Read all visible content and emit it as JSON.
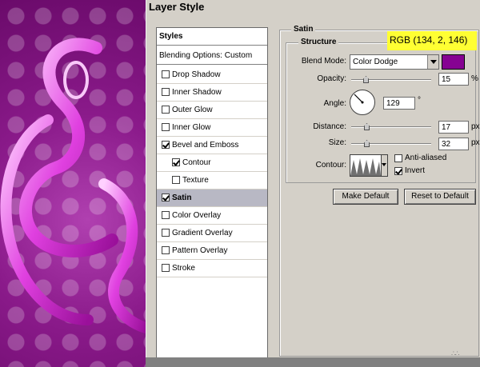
{
  "window": {
    "title": "Layer Style"
  },
  "styles_list": {
    "header": "Styles",
    "blending": "Blending Options: Custom",
    "items": [
      {
        "label": "Drop Shadow",
        "checked": false,
        "selected": false
      },
      {
        "label": "Inner Shadow",
        "checked": false,
        "selected": false
      },
      {
        "label": "Outer Glow",
        "checked": false,
        "selected": false
      },
      {
        "label": "Inner Glow",
        "checked": false,
        "selected": false
      },
      {
        "label": "Bevel and Emboss",
        "checked": true,
        "selected": false
      },
      {
        "label": "Contour",
        "checked": true,
        "selected": false
      },
      {
        "label": "Texture",
        "checked": false,
        "selected": false
      },
      {
        "label": "Satin",
        "checked": true,
        "selected": true
      },
      {
        "label": "Color Overlay",
        "checked": false,
        "selected": false
      },
      {
        "label": "Gradient Overlay",
        "checked": false,
        "selected": false
      },
      {
        "label": "Pattern Overlay",
        "checked": false,
        "selected": false
      },
      {
        "label": "Stroke",
        "checked": false,
        "selected": false
      }
    ]
  },
  "satin": {
    "group_title": "Satin",
    "structure_title": "Structure",
    "blend_mode_label": "Blend Mode:",
    "blend_mode_value": "Color Dodge",
    "color": "#860292",
    "opacity_label": "Opacity:",
    "opacity_value": "15",
    "opacity_unit": "%",
    "angle_label": "Angle:",
    "angle_value": "129",
    "angle_unit": "°",
    "distance_label": "Distance:",
    "distance_value": "17",
    "distance_unit": "px",
    "size_label": "Size:",
    "size_value": "32",
    "size_unit": "px",
    "contour_label": "Contour:",
    "anti_aliased_label": "Anti-aliased",
    "anti_aliased_checked": false,
    "invert_label": "Invert",
    "invert_checked": true,
    "make_default_label": "Make Default",
    "reset_default_label": "Reset to Default"
  },
  "annotation": {
    "text": "RGB (134, 2, 146)",
    "color": "#ffff33"
  }
}
